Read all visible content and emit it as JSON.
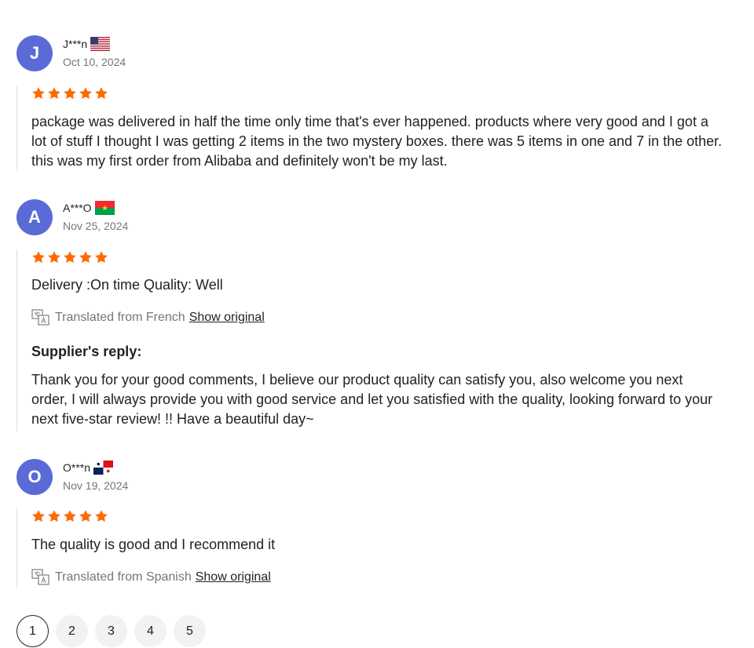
{
  "reviews": [
    {
      "avatar_letter": "J",
      "username": "J***n",
      "flag": "us-flag-icon",
      "date": "Oct 10, 2024",
      "rating": 5,
      "text": "package was delivered in half the time only time that's ever happened. products where very good and I got a lot of stuff I thought I was getting 2 items in the two mystery boxes. there was 5 items in one and 7 in the other. this was my first order from Alibaba and definitely won't be my last."
    },
    {
      "avatar_letter": "A",
      "username": "A***O",
      "flag": "burkina-faso-flag-icon",
      "date": "Nov 25, 2024",
      "rating": 5,
      "text": "Delivery :On time Quality: Well",
      "translated_label": "Translated from French",
      "show_original": "Show original",
      "reply_title": "Supplier's reply:",
      "reply_text": "Thank you for your good comments, I believe our product quality can satisfy you, also welcome you next order, I will always provide you with good service and let you satisfied with the quality, looking forward to your next five-star review! !! Have a beautiful day~"
    },
    {
      "avatar_letter": "O",
      "username": "O***n",
      "flag": "panama-flag-icon",
      "date": "Nov 19, 2024",
      "rating": 5,
      "text": "The quality is good and I recommend it",
      "translated_label": "Translated from Spanish",
      "show_original": "Show original"
    }
  ],
  "pagination": {
    "pages": [
      "1",
      "2",
      "3",
      "4",
      "5"
    ],
    "current": "1"
  },
  "colors": {
    "avatar": "#5a6bd8",
    "star": "#ff6a00",
    "muted": "#767676"
  }
}
